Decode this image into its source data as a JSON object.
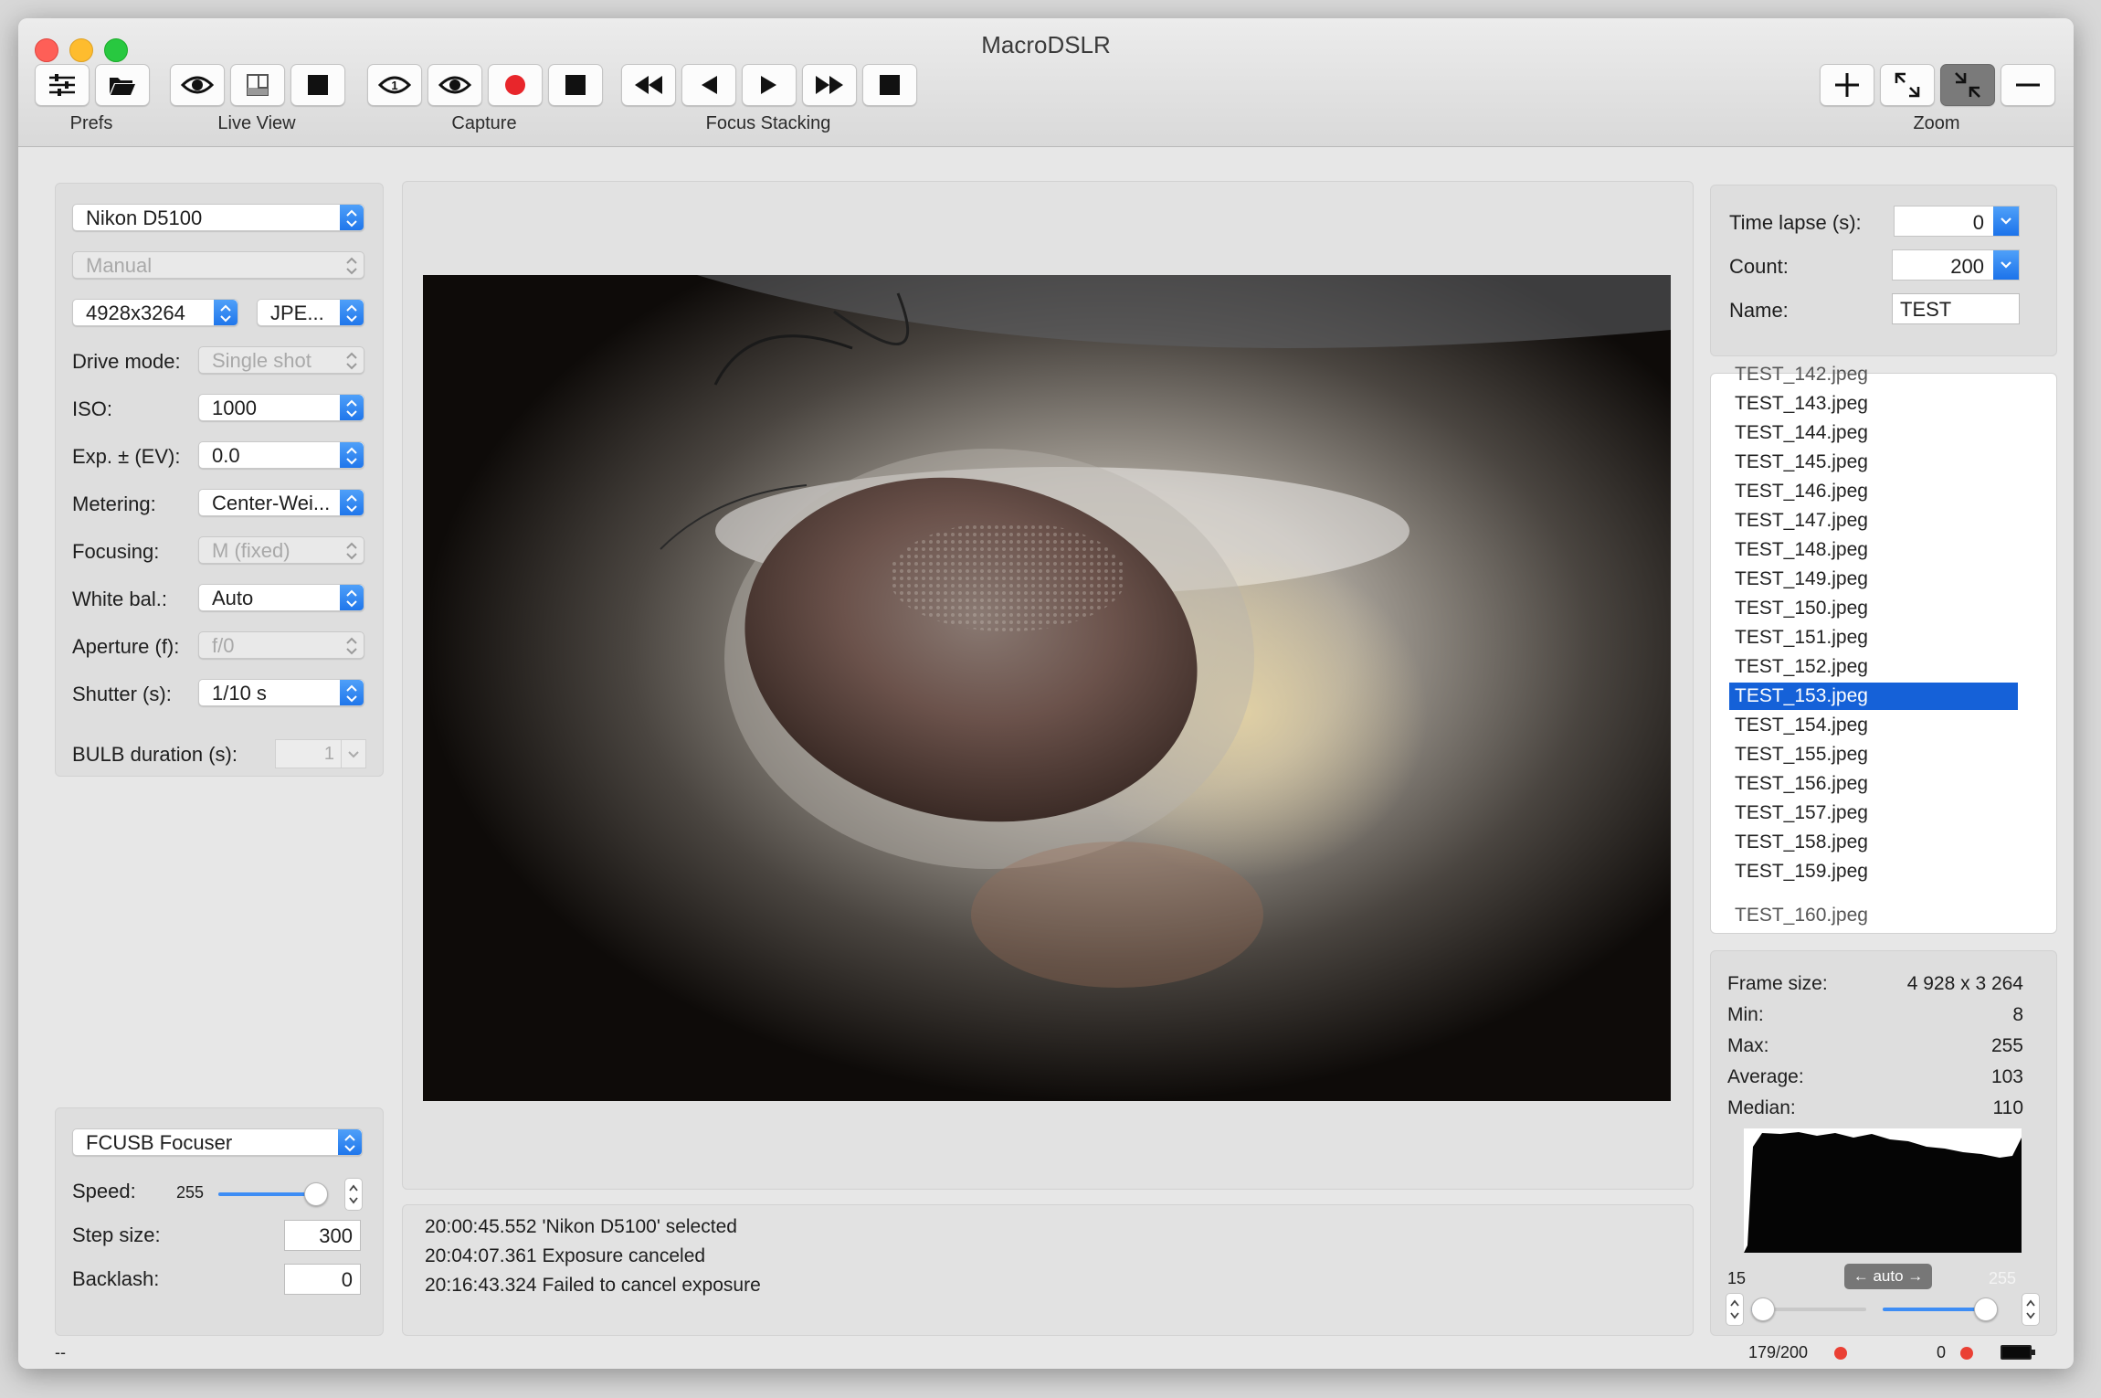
{
  "window": {
    "title": "MacroDSLR"
  },
  "toolbar": {
    "groups": [
      {
        "label": "Prefs"
      },
      {
        "label": "Live View"
      },
      {
        "label": "Capture"
      },
      {
        "label": "Focus Stacking"
      },
      {
        "label": "Zoom"
      }
    ]
  },
  "camera": {
    "model": "Nikon D5100",
    "mode": "Manual",
    "resolution": "4928x3264",
    "format": "JPE...",
    "settings": [
      {
        "label": "Drive mode:",
        "value": "Single shot",
        "enabled": false
      },
      {
        "label": "ISO:",
        "value": "1000",
        "enabled": true
      },
      {
        "label": "Exp. ± (EV):",
        "value": "0.0",
        "enabled": true
      },
      {
        "label": "Metering:",
        "value": "Center-Wei...",
        "enabled": true
      },
      {
        "label": "Focusing:",
        "value": "M (fixed)",
        "enabled": false
      },
      {
        "label": "White bal.:",
        "value": "Auto",
        "enabled": true
      },
      {
        "label": "Aperture (f):",
        "value": "f/0",
        "enabled": false
      },
      {
        "label": "Shutter (s):",
        "value": "1/10 s",
        "enabled": true
      }
    ],
    "bulb_label": "BULB duration (s):",
    "bulb_value": "1"
  },
  "focuser": {
    "device": "FCUSB Focuser",
    "speed_label": "Speed:",
    "speed_value": "255",
    "speed_level": 1.0,
    "step_label": "Step size:",
    "step_value": "300",
    "backlash_label": "Backlash:",
    "backlash_value": "0"
  },
  "timelapse": {
    "interval_label": "Time lapse (s):",
    "interval_value": "0",
    "count_label": "Count:",
    "count_value": "200",
    "name_label": "Name:",
    "name_value": "TEST"
  },
  "files": {
    "top_partial": "TEST_142.jpeg",
    "items": [
      "TEST_143.jpeg",
      "TEST_144.jpeg",
      "TEST_145.jpeg",
      "TEST_146.jpeg",
      "TEST_147.jpeg",
      "TEST_148.jpeg",
      "TEST_149.jpeg",
      "TEST_150.jpeg",
      "TEST_151.jpeg",
      "TEST_152.jpeg",
      "TEST_153.jpeg",
      "TEST_154.jpeg",
      "TEST_155.jpeg",
      "TEST_156.jpeg",
      "TEST_157.jpeg",
      "TEST_158.jpeg",
      "TEST_159.jpeg"
    ],
    "bottom_partial": "TEST_160.jpeg",
    "selected": "TEST_153.jpeg"
  },
  "stats": {
    "frame_label": "Frame size:",
    "frame_value": "4 928 x 3 264",
    "min_label": "Min:",
    "min_value": "8",
    "max_label": "Max:",
    "max_value": "255",
    "avg_label": "Average:",
    "avg_value": "103",
    "median_label": "Median:",
    "median_value": "110",
    "hist_low": "15",
    "hist_high": "255",
    "auto_label": "← auto →"
  },
  "log": [
    "20:00:45.552 'Nikon D5100' selected",
    "20:04:07.361 Exposure canceled",
    "20:16:43.324 Failed to cancel exposure"
  ],
  "status": {
    "left": "--",
    "progress": "179/200",
    "count2": "0"
  },
  "colors": {
    "accent": "#1c73ea",
    "selection": "#1561d8",
    "record": "#e8262b",
    "status_dot": "#ea4034"
  }
}
